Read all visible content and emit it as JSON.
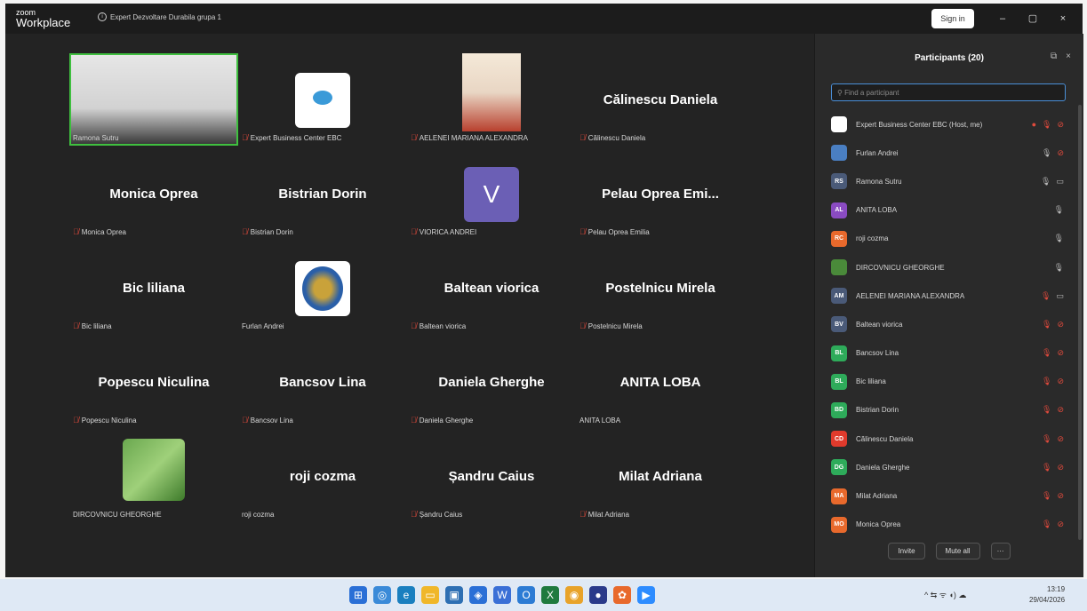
{
  "titlebar": {
    "brand_top": "zoom",
    "brand_bottom": "Workplace",
    "meeting_title": "Expert Dezvoltare Durabila grupa 1",
    "signin_label": "Sign in",
    "minimize": "–",
    "maximize": "▢",
    "close": "×"
  },
  "gallery": [
    {
      "center": "",
      "label": "Ramona Sutru",
      "muted": false,
      "type": "video"
    },
    {
      "center": "",
      "label": "Expert Business Center EBC",
      "muted": true,
      "type": "logo"
    },
    {
      "center": "",
      "label": "AELENEI MARIANA ALEXANDRA",
      "muted": true,
      "type": "video"
    },
    {
      "center": "Călinescu Daniela",
      "label": "Călinescu Daniela",
      "muted": true,
      "type": "name"
    },
    {
      "center": "Monica Oprea",
      "label": "Monica Oprea",
      "muted": true,
      "type": "name"
    },
    {
      "center": "Bistrian Dorin",
      "label": "Bistrian Dorin",
      "muted": true,
      "type": "name"
    },
    {
      "center": "V",
      "label": "VIORICA ANDREI",
      "muted": true,
      "type": "letter"
    },
    {
      "center": "Pelau Oprea Emi...",
      "label": "Pelau Oprea Emilia",
      "muted": true,
      "type": "name"
    },
    {
      "center": "Bic liliana",
      "label": "Bic liliana",
      "muted": true,
      "type": "name"
    },
    {
      "center": "",
      "label": "Furlan Andrei",
      "muted": false,
      "type": "crest"
    },
    {
      "center": "Baltean viorica",
      "label": "Baltean viorica",
      "muted": true,
      "type": "name"
    },
    {
      "center": "Postelnicu Mirela",
      "label": "Postelnicu Mirela",
      "muted": true,
      "type": "name"
    },
    {
      "center": "Popescu Niculina",
      "label": "Popescu Niculina",
      "muted": true,
      "type": "name"
    },
    {
      "center": "Bancsov  Lina",
      "label": "Bancsov  Lina",
      "muted": true,
      "type": "name"
    },
    {
      "center": "Daniela Gherghe",
      "label": "Daniela Gherghe",
      "muted": true,
      "type": "name"
    },
    {
      "center": "ANITA LOBA",
      "label": "ANITA LOBA",
      "muted": false,
      "type": "name"
    },
    {
      "center": "",
      "label": "DIRCOVNICU GHEORGHE",
      "muted": false,
      "type": "photo"
    },
    {
      "center": "roji cozma",
      "label": "roji cozma",
      "muted": false,
      "type": "name"
    },
    {
      "center": "Șandru Caius",
      "label": "Șandru Caius",
      "muted": true,
      "type": "name"
    },
    {
      "center": "Milat Adriana",
      "label": "Milat Adriana",
      "muted": true,
      "type": "name"
    }
  ],
  "panel": {
    "title": "Participants (20)",
    "search_placeholder": "Find a participant",
    "participants": [
      {
        "initials": "",
        "name": "Expert Business Center EBC (Host, me)",
        "color": "#ffffff",
        "status": "host"
      },
      {
        "initials": "",
        "name": "Furlan Andrei",
        "color": "#4a7fc2",
        "status": "mic-on-video-off"
      },
      {
        "initials": "RS",
        "name": "Ramona Sutru",
        "color": "#4a5a78",
        "status": "mic-on-video-on"
      },
      {
        "initials": "AL",
        "name": "ANITA LOBA",
        "color": "#8a4bc2",
        "status": "mic-on"
      },
      {
        "initials": "RC",
        "name": "roji cozma",
        "color": "#e8692c",
        "status": "mic-on"
      },
      {
        "initials": "",
        "name": "DIRCOVNICU GHEORGHE",
        "color": "#4a8a3a",
        "status": "mic-on"
      },
      {
        "initials": "AM",
        "name": "AELENEI MARIANA ALEXANDRA",
        "color": "#4a5a78",
        "status": "muted-video-on"
      },
      {
        "initials": "BV",
        "name": "Baltean viorica",
        "color": "#4a5a78",
        "status": "muted-video-off"
      },
      {
        "initials": "BL",
        "name": "Bancsov  Lina",
        "color": "#2eab5a",
        "status": "muted-video-off"
      },
      {
        "initials": "BL",
        "name": "Bic liliana",
        "color": "#2eab5a",
        "status": "muted-video-off"
      },
      {
        "initials": "BD",
        "name": "Bistrian Dorin",
        "color": "#2eab5a",
        "status": "muted-video-off"
      },
      {
        "initials": "CD",
        "name": "Călinescu Daniela",
        "color": "#e03a2c",
        "status": "muted-video-off"
      },
      {
        "initials": "DG",
        "name": "Daniela Gherghe",
        "color": "#2eab5a",
        "status": "muted-video-off"
      },
      {
        "initials": "MA",
        "name": "Milat Adriana",
        "color": "#e8692c",
        "status": "muted-video-off"
      },
      {
        "initials": "MO",
        "name": "Monica Oprea",
        "color": "#e8692c",
        "status": "muted-video-off"
      }
    ],
    "invite_label": "Invite",
    "mute_all_label": "Mute all",
    "more_label": "···"
  },
  "taskbar": {
    "time": "13:19",
    "date": "29/04/2026",
    "tray": "^  ⇆  ᯤ  ◖)  ☁"
  }
}
